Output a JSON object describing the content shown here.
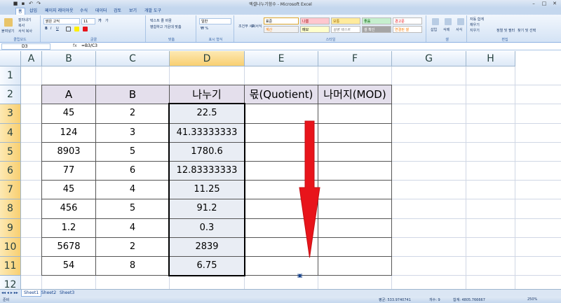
{
  "window": {
    "title": "엑셀나누기함수 - Microsoft Excel"
  },
  "tabs": [
    "홈",
    "삽입",
    "페이지 레이아웃",
    "수식",
    "데이터",
    "검토",
    "보기",
    "개발 도구"
  ],
  "ribbon": {
    "clipboard": {
      "paste": "붙여넣기",
      "cut": "잘라내기",
      "copy": "복사",
      "format_painter": "서식 복사",
      "label": "클립보드"
    },
    "font": {
      "name": "맑은 고딕",
      "size": "11",
      "label": "글꼴"
    },
    "alignment": {
      "wrap": "텍스트 줄 바꿈",
      "merge": "병합하고 가운데 맞춤",
      "label": "맞춤"
    },
    "number": {
      "format": "일반",
      "label": "표시 형식"
    },
    "styles": {
      "conditional": "조건부 서식",
      "table": "표 서식",
      "cell_styles": [
        "표준",
        "나쁨",
        "보통",
        "좋음",
        "경고문",
        "계산",
        "메모",
        "설명 텍스트",
        "셀 확인",
        "연결된 셀"
      ],
      "label": "스타일"
    },
    "cells": {
      "insert": "삽입",
      "delete": "삭제",
      "format": "서식",
      "label": "셀"
    },
    "editing": {
      "autosum": "자동 합계",
      "fill": "채우기",
      "clear": "지우기",
      "sort": "정렬 및 필터",
      "find": "찾기 및 선택",
      "label": "편집"
    }
  },
  "formula_bar": {
    "name_box": "D3",
    "fx": "fx",
    "formula": "=B3/C3"
  },
  "columns": [
    "A",
    "B",
    "C",
    "D",
    "E",
    "F",
    "G",
    "H"
  ],
  "selected_column": "D",
  "rows": [
    "1",
    "2",
    "3",
    "4",
    "5",
    "6",
    "7",
    "8",
    "9",
    "10",
    "11",
    "12"
  ],
  "table": {
    "headers": [
      "A",
      "B",
      "나누기",
      "몫(Quotient)",
      "나머지(MOD)"
    ],
    "rows": [
      [
        "45",
        "2",
        "22.5",
        "",
        ""
      ],
      [
        "124",
        "3",
        "41.33333333",
        "",
        ""
      ],
      [
        "8903",
        "5",
        "1780.6",
        "",
        ""
      ],
      [
        "77",
        "6",
        "12.83333333",
        "",
        ""
      ],
      [
        "45",
        "4",
        "11.25",
        "",
        ""
      ],
      [
        "456",
        "5",
        "91.2",
        "",
        ""
      ],
      [
        "1.2",
        "4",
        "0.3",
        "",
        ""
      ],
      [
        "5678",
        "2",
        "2839",
        "",
        ""
      ],
      [
        "54",
        "8",
        "6.75",
        "",
        ""
      ]
    ]
  },
  "sheets": [
    "Sheet1",
    "Sheet2",
    "Sheet3"
  ],
  "status": {
    "mode": "준비",
    "average": "평균: 533.9740741",
    "count": "개수: 9",
    "sum": "합계: 4805.766667",
    "zoom": "250%"
  },
  "colors": {
    "arrow": "#e8141b",
    "header_fill": "#e4dfec",
    "d_fill": "#e9edf4",
    "selected_header": "#f8cf71"
  }
}
